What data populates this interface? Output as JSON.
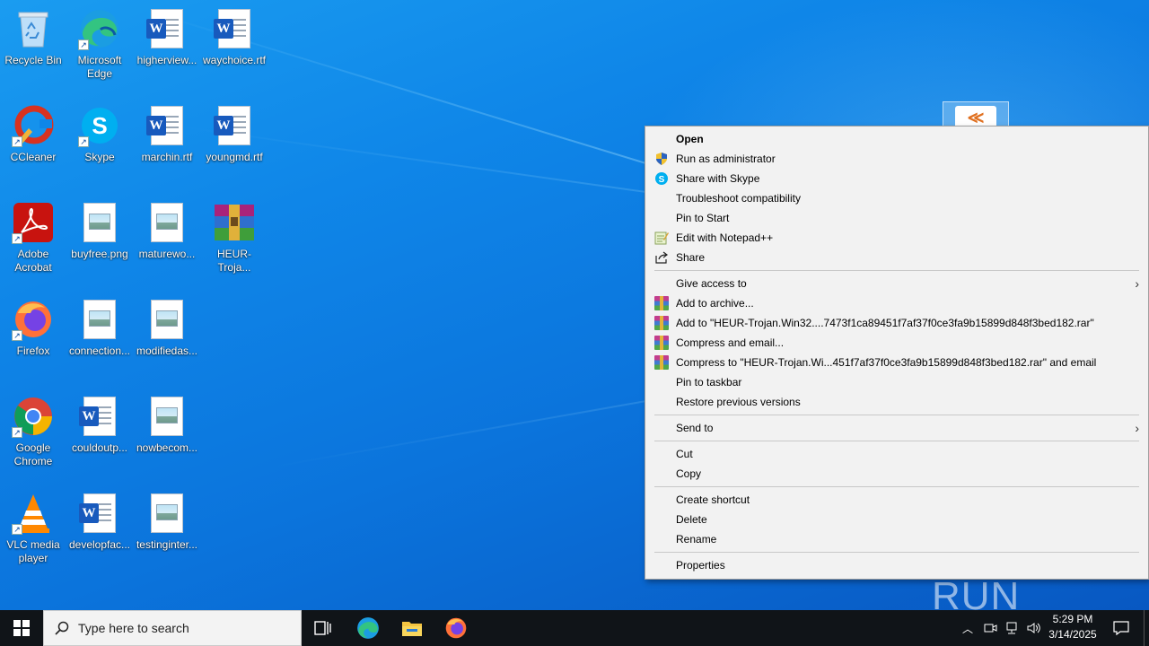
{
  "desktop": {
    "icons": [
      {
        "label": "Recycle Bin",
        "icon": "recycle-bin-icon"
      },
      {
        "label": "Microsoft Edge",
        "icon": "edge-icon"
      },
      {
        "label": "higherview...",
        "icon": "word-doc-icon"
      },
      {
        "label": "waychoice.rtf",
        "icon": "word-doc-icon"
      },
      {
        "label": "CCleaner",
        "icon": "ccleaner-icon"
      },
      {
        "label": "Skype",
        "icon": "skype-icon"
      },
      {
        "label": "marchin.rtf",
        "icon": "word-doc-icon"
      },
      {
        "label": "youngmd.rtf",
        "icon": "word-doc-icon"
      },
      {
        "label": "Adobe Acrobat",
        "icon": "acrobat-icon"
      },
      {
        "label": "buyfree.png",
        "icon": "image-file-icon"
      },
      {
        "label": "maturewo...",
        "icon": "image-file-icon"
      },
      {
        "label": "HEUR-Troja...",
        "icon": "winrar-archive-icon"
      },
      {
        "label": "Firefox",
        "icon": "firefox-icon"
      },
      {
        "label": "connection...",
        "icon": "image-file-icon"
      },
      {
        "label": "modifiedas...",
        "icon": "image-file-icon"
      },
      {
        "label": "Google Chrome",
        "icon": "chrome-icon"
      },
      {
        "label": "couldoutp...",
        "icon": "word-doc-icon"
      },
      {
        "label": "nowbecom...",
        "icon": "image-file-icon"
      },
      {
        "label": "VLC media player",
        "icon": "vlc-icon"
      },
      {
        "label": "developfac...",
        "icon": "word-doc-icon"
      },
      {
        "label": "testinginter...",
        "icon": "image-file-icon"
      }
    ],
    "watermark": "ANY RUN"
  },
  "context_menu": {
    "items": [
      {
        "label": "Open",
        "icon": "",
        "bold": true
      },
      {
        "label": "Run as administrator",
        "icon": "uac-shield-icon"
      },
      {
        "label": "Share with Skype",
        "icon": "skype-icon"
      },
      {
        "label": "Troubleshoot compatibility",
        "icon": ""
      },
      {
        "label": "Pin to Start",
        "icon": ""
      },
      {
        "label": "Edit with Notepad++",
        "icon": "notepadpp-icon"
      },
      {
        "label": "Share",
        "icon": "share-icon"
      },
      {
        "label": "Give access to",
        "icon": "",
        "submenu": true
      },
      {
        "label": "Add to archive...",
        "icon": "winrar-icon"
      },
      {
        "label": "Add to \"HEUR-Trojan.Win32....7473f1ca89451f7af37f0ce3fa9b15899d848f3bed182.rar\"",
        "icon": "winrar-icon"
      },
      {
        "label": "Compress and email...",
        "icon": "winrar-icon"
      },
      {
        "label": "Compress to \"HEUR-Trojan.Wi...451f7af37f0ce3fa9b15899d848f3bed182.rar\" and email",
        "icon": "winrar-icon"
      },
      {
        "label": "Pin to taskbar",
        "icon": ""
      },
      {
        "label": "Restore previous versions",
        "icon": ""
      },
      {
        "label": "Send to",
        "icon": "",
        "submenu": true
      },
      {
        "label": "Cut",
        "icon": ""
      },
      {
        "label": "Copy",
        "icon": ""
      },
      {
        "label": "Create shortcut",
        "icon": ""
      },
      {
        "label": "Delete",
        "icon": ""
      },
      {
        "label": "Rename",
        "icon": ""
      },
      {
        "label": "Properties",
        "icon": ""
      }
    ]
  },
  "taskbar": {
    "search_placeholder": "Type here to search",
    "pinned": [
      "task-view-icon",
      "edge-icon",
      "file-explorer-icon",
      "firefox-icon"
    ],
    "clock_time": "5:29 PM",
    "clock_date": "3/14/2025"
  },
  "colors": {
    "desktop_blue": "#0b74dc",
    "taskbar": "#101418",
    "menu_bg": "#f2f2f2"
  }
}
